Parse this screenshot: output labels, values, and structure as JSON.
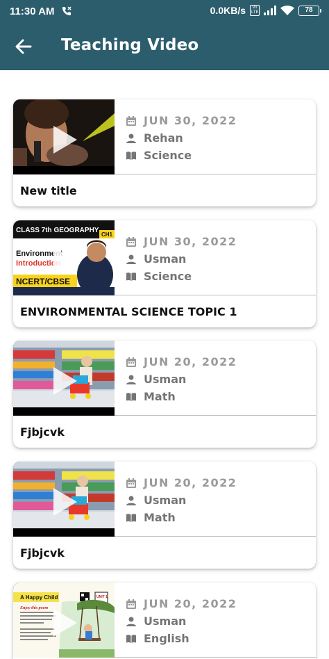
{
  "status_bar": {
    "time": "11:30 AM",
    "network_speed": "0.0KB/s",
    "volte": "Vo LTE",
    "battery": "78"
  },
  "header": {
    "title": "Teaching Video",
    "back_icon": "arrow-left-icon"
  },
  "colors": {
    "header_bg": "#2c5d6c",
    "date_text": "#9a9a9a",
    "meta_text": "#757575"
  },
  "videos": [
    {
      "date": "JUN 30, 2022",
      "teacher": "Rehan",
      "subject": "Science",
      "title": "New title"
    },
    {
      "date": "JUN 30, 2022",
      "teacher": "Usman",
      "subject": "Science",
      "title": "ENVIRONMENTAL SCIENCE TOPIC 1",
      "thumb_text": {
        "banner": "CLASS 7th GEOGRAPHY",
        "chapter": "CH1",
        "line1": "Environment",
        "line2": "Introduction",
        "footer": "NCERT/CBSE"
      }
    },
    {
      "date": "JUN 20, 2022",
      "teacher": "Usman",
      "subject": "Math",
      "title": "Fjbjcvk"
    },
    {
      "date": "JUN 20, 2022",
      "teacher": "Usman",
      "subject": "Math",
      "title": "Fjbjcvk"
    },
    {
      "date": "JUN 20, 2022",
      "teacher": "Usman",
      "subject": "English",
      "title": "",
      "thumb_text": {
        "heading": "A Happy Child",
        "unit": "UNIT 1",
        "subheading": "Enjoy this poem"
      }
    }
  ]
}
